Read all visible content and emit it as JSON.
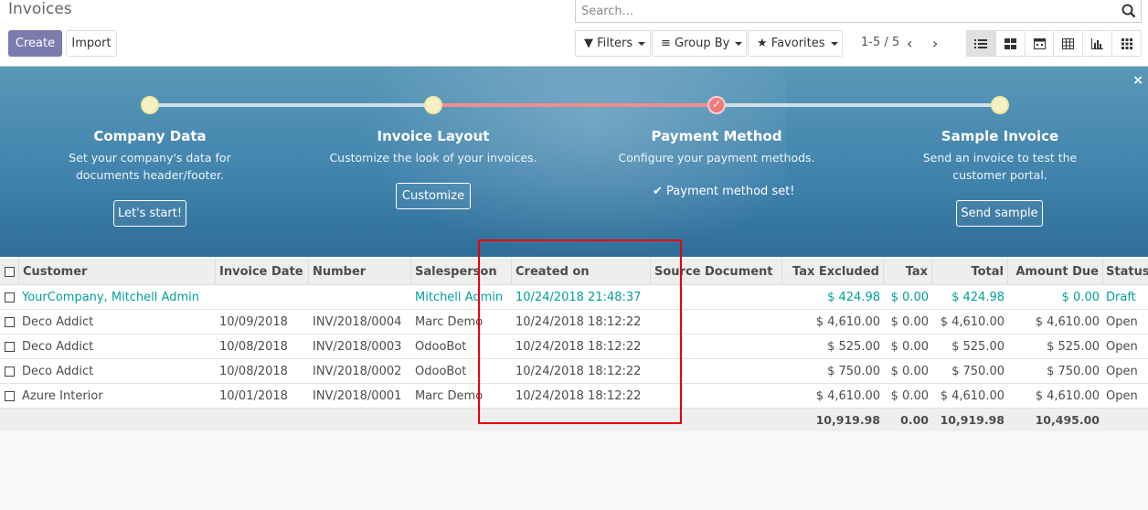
{
  "page": {
    "title": "Invoices"
  },
  "buttons": {
    "create": "Create",
    "import": "Import"
  },
  "search": {
    "placeholder": "Search...",
    "icon": "search-icon"
  },
  "filters": {
    "filters": "Filters",
    "group_by": "Group By",
    "favorites": "Favorites"
  },
  "pager": {
    "text": "1-5 / 5"
  },
  "views": [
    "list-view-icon",
    "kanban-view-icon",
    "calendar-view-icon",
    "pivot-view-icon",
    "graph-view-icon",
    "grid-view-icon"
  ],
  "banner": {
    "close": "×",
    "steps": [
      {
        "title": "Company Data",
        "desc": "Set your company's data for documents header/footer.",
        "button": "Let's start!"
      },
      {
        "title": "Invoice Layout",
        "desc": "Customize the look of your invoices.",
        "button": "Customize"
      },
      {
        "title": "Payment Method",
        "desc": "Configure your payment methods.",
        "status": "Payment method set!"
      },
      {
        "title": "Sample Invoice",
        "desc": "Send an invoice to test the customer portal.",
        "button": "Send sample"
      }
    ]
  },
  "table": {
    "headers": [
      "Customer",
      "Invoice Date",
      "Number",
      "Salesperson",
      "Created on",
      "Source Document",
      "Tax Excluded",
      "Tax",
      "Total",
      "Amount Due",
      "Status"
    ],
    "rows": [
      {
        "customer": "YourCompany, Mitchell Admin",
        "date": "",
        "number": "",
        "salesperson": "Mitchell Admin",
        "created": "10/24/2018 21:48:37",
        "source": "",
        "tax_excl": "$ 424.98",
        "tax": "$ 0.00",
        "total": "$ 424.98",
        "due": "$ 0.00",
        "status": "Draft"
      },
      {
        "customer": "Deco Addict",
        "date": "10/09/2018",
        "number": "INV/2018/0004",
        "salesperson": "Marc Demo",
        "created": "10/24/2018 18:12:22",
        "source": "",
        "tax_excl": "$ 4,610.00",
        "tax": "$ 0.00",
        "total": "$ 4,610.00",
        "due": "$ 4,610.00",
        "status": "Open"
      },
      {
        "customer": "Deco Addict",
        "date": "10/08/2018",
        "number": "INV/2018/0003",
        "salesperson": "OdooBot",
        "created": "10/24/2018 18:12:22",
        "source": "",
        "tax_excl": "$ 525.00",
        "tax": "$ 0.00",
        "total": "$ 525.00",
        "due": "$ 525.00",
        "status": "Open"
      },
      {
        "customer": "Deco Addict",
        "date": "10/08/2018",
        "number": "INV/2018/0002",
        "salesperson": "OdooBot",
        "created": "10/24/2018 18:12:22",
        "source": "",
        "tax_excl": "$ 750.00",
        "tax": "$ 0.00",
        "total": "$ 750.00",
        "due": "$ 750.00",
        "status": "Open"
      },
      {
        "customer": "Azure Interior",
        "date": "10/01/2018",
        "number": "INV/2018/0001",
        "salesperson": "Marc Demo",
        "created": "10/24/2018 18:12:22",
        "source": "",
        "tax_excl": "$ 4,610.00",
        "tax": "$ 0.00",
        "total": "$ 4,610.00",
        "due": "$ 4,610.00",
        "status": "Open"
      }
    ],
    "footer": {
      "tax_excl": "10,919.98",
      "tax": "0.00",
      "total": "10,919.98",
      "due": "10,495.00"
    }
  },
  "colors": {
    "accent": "#7c7bad",
    "draft": "#00a09d",
    "highlight": "#e8000a"
  }
}
